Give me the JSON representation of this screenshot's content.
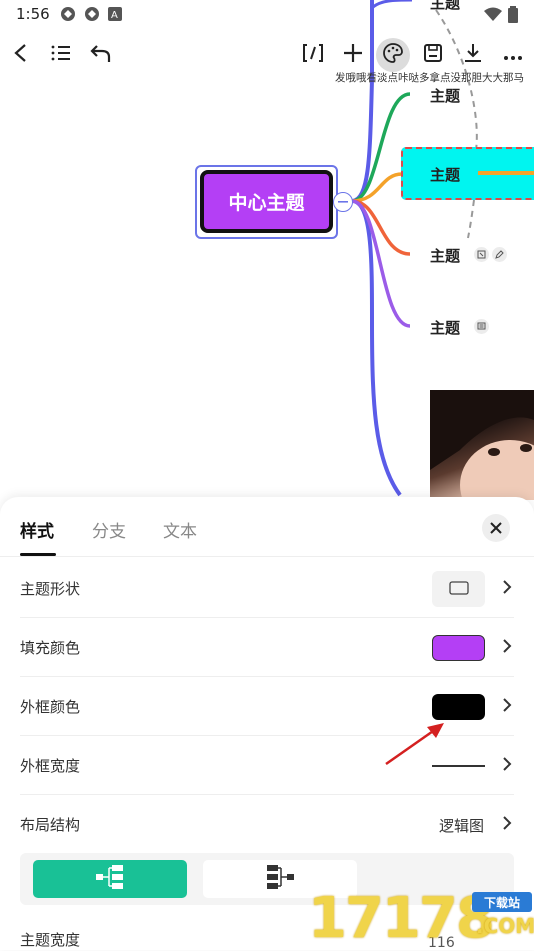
{
  "status_bar": {
    "time": "1:56",
    "icons": [
      "app-notification-icon",
      "app-notification-icon",
      "a-letter-icon",
      "wifi-icon",
      "battery-icon"
    ]
  },
  "toolbar": {
    "buttons": [
      "back-icon",
      "outline-list-icon",
      "undo-icon",
      "bracket-icon",
      "plus-icon",
      "palette-icon",
      "save-icon",
      "download-icon",
      "more-icon"
    ],
    "tooltip": "发哦哦看淡点咔哒多拿点没那胆大大那马"
  },
  "mindmap": {
    "central_topic": "中心主题",
    "topics": [
      "主题",
      "主题",
      "主题",
      "主题",
      "主题"
    ],
    "branch_colors": [
      "#5b5ce8",
      "#1ea85a",
      "#f4a22a",
      "#f0643a",
      "#9b5ce8"
    ]
  },
  "panel": {
    "tabs": [
      "样式",
      "分支",
      "文本"
    ],
    "active_tab": "样式",
    "rows": {
      "shape_label": "主题形状",
      "fill_label": "填充颜色",
      "fill_color": "#b43ff5",
      "border_color_label": "外框颜色",
      "border_color": "#000000",
      "border_width_label": "外框宽度",
      "layout_label": "布局结构",
      "layout_value": "逻辑图",
      "topic_width_label": "主题宽度",
      "topic_width_value": "116"
    },
    "layout_options": [
      "logic-right-layout-icon",
      "logic-left-layout-icon"
    ],
    "active_layout_color": "#19c196"
  },
  "watermark": {
    "number": "17178",
    "badge": "下载站",
    "domain": ".COM"
  }
}
